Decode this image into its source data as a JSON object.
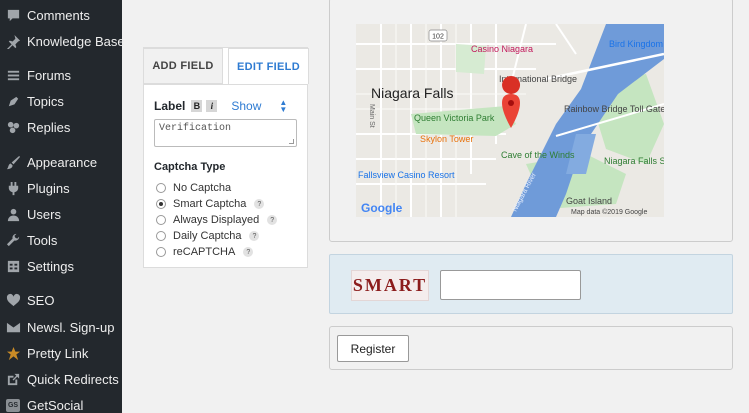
{
  "sidebar": {
    "items": [
      {
        "label": "Comments",
        "icon": "comment-icon"
      },
      {
        "label": "Knowledge Base",
        "icon": "pin-icon"
      },
      {
        "label": "Forums",
        "icon": "forums-icon"
      },
      {
        "label": "Topics",
        "icon": "topics-icon"
      },
      {
        "label": "Replies",
        "icon": "replies-icon"
      },
      {
        "label": "Appearance",
        "icon": "paintbrush-icon"
      },
      {
        "label": "Plugins",
        "icon": "plugin-icon"
      },
      {
        "label": "Users",
        "icon": "users-icon"
      },
      {
        "label": "Tools",
        "icon": "wrench-icon"
      },
      {
        "label": "Settings",
        "icon": "settings-icon"
      },
      {
        "label": "SEO",
        "icon": "seo-icon"
      },
      {
        "label": "Newsl. Sign-up",
        "icon": "mail-icon"
      },
      {
        "label": "Pretty Link",
        "icon": "star-icon"
      },
      {
        "label": "Quick Redirects",
        "icon": "redirect-icon"
      },
      {
        "label": "GetSocial",
        "icon": "getsocial-icon",
        "badge": "GS"
      }
    ]
  },
  "editor": {
    "tabs": {
      "add": "ADD FIELD",
      "edit": "EDIT FIELD"
    },
    "label_title": "Label",
    "bold": "B",
    "italic": "i",
    "show": "Show",
    "label_value": "Verification",
    "captcha_type_title": "Captcha Type",
    "captcha_options": [
      {
        "label": "No Captcha",
        "checked": false,
        "help": false
      },
      {
        "label": "Smart Captcha",
        "checked": true,
        "help": true
      },
      {
        "label": "Always Displayed",
        "checked": false,
        "help": true
      },
      {
        "label": "Daily Captcha",
        "checked": false,
        "help": true
      },
      {
        "label": "reCAPTCHA",
        "checked": false,
        "help": true
      }
    ],
    "help_symbol": "?"
  },
  "map": {
    "labels": {
      "city": "Niagara Falls",
      "casino": "Casino Niagara",
      "bridge": "International Bridge",
      "bird": "Bird Kingdom",
      "park": "Queen Victoria Park",
      "tower": "Skylon Tower",
      "rainbow": "Rainbow Bridge Toll Gate",
      "cave": "Cave of the Winds",
      "state_park": "Niagara Falls State Park",
      "fallsview": "Fallsview Casino Resort",
      "goat": "Goat Island",
      "river": "Niagara River",
      "main_st": "Main St",
      "route": "102"
    },
    "google": "Google",
    "attribution": "Map data ©2019 Google"
  },
  "captcha": {
    "text": "SMART"
  },
  "register": {
    "label": "Register"
  }
}
